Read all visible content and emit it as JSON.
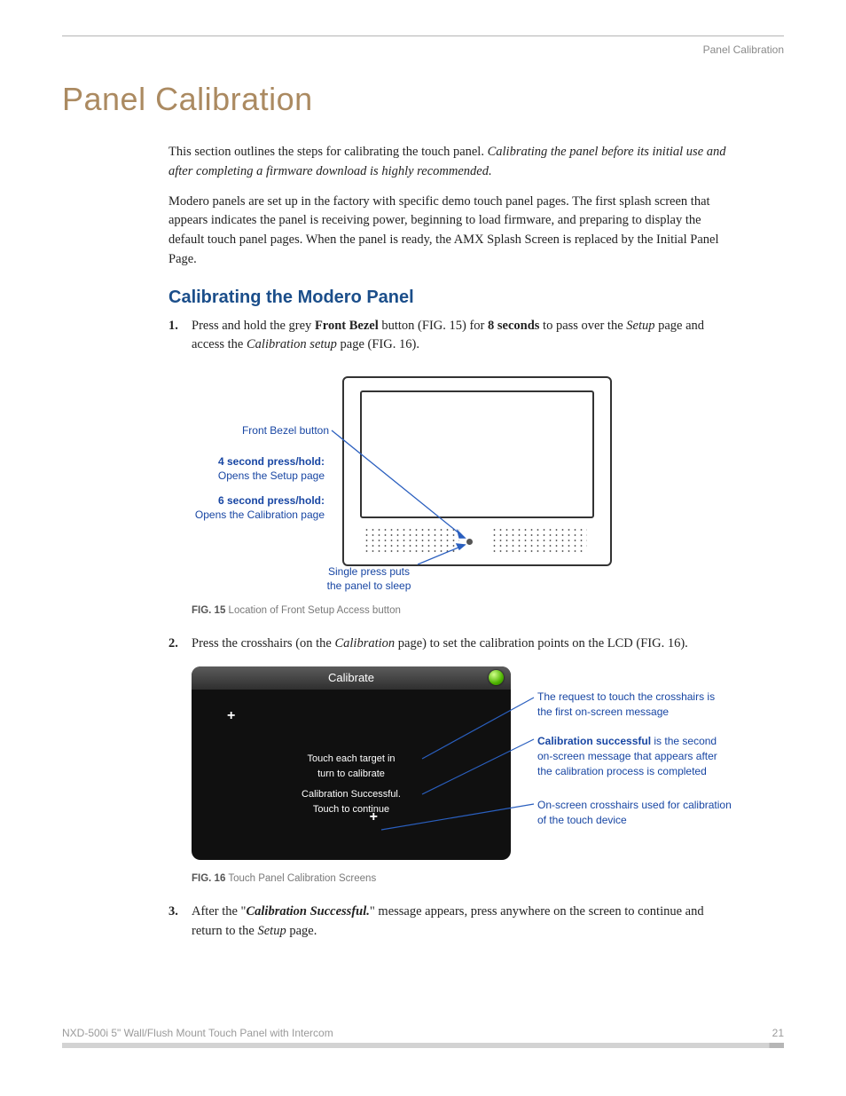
{
  "running_head": "Panel Calibration",
  "title": "Panel Calibration",
  "intro": {
    "p1_a": "This section outlines the steps for calibrating the touch panel. ",
    "p1_b": "Calibrating the panel before its initial use and after completing a firmware download is highly recommended.",
    "p2": "Modero panels are set up in the factory with specific demo touch panel pages. The first splash screen that appears indicates the panel is receiving power, beginning to load firmware, and preparing to display the default touch panel pages. When the panel is ready, the AMX Splash Screen is replaced by the Initial Panel Page."
  },
  "sub1": "Calibrating the Modero Panel",
  "step1": {
    "a": "Press and hold the grey ",
    "b": "Front Bezel",
    "c": " button (FIG. 15) for ",
    "d": "8 seconds",
    "e": " to pass over the ",
    "f": "Setup",
    "g": " page and access the ",
    "h": "Calibration setup",
    "i": " page (FIG. 16)."
  },
  "fig15": {
    "labels": {
      "bezel": "Front Bezel button",
      "hold4_title": "4 second press/hold:",
      "hold4_sub": "Opens the Setup page",
      "hold6_title": "6 second press/hold:",
      "hold6_sub": "Opens the Calibration page",
      "single_a": "Single press puts",
      "single_b": "the panel to sleep"
    },
    "caption_num": "FIG. 15",
    "caption": "  Location of Front Setup Access button"
  },
  "step2": {
    "a": "Press the crosshairs (on the ",
    "b": "Calibration",
    "c": " page) to set the calibration points on the LCD (FIG. 16)."
  },
  "fig16": {
    "screen": {
      "title": "Calibrate",
      "msg1_a": "Touch each target in",
      "msg1_b": "turn to calibrate",
      "msg2_a": "Calibration Successful.",
      "msg2_b": "Touch to continue",
      "cross": "+"
    },
    "annot1": "The request to touch the crosshairs is the first on-screen message",
    "annot2_bold": "Calibration successful",
    "annot2_rest": " is the second on-screen message that appears after the calibration process is completed",
    "annot3": "On-screen crosshairs used for calibration of the touch device",
    "caption_num": "FIG. 16",
    "caption": "  Touch Panel Calibration Screens"
  },
  "step3": {
    "a": "After the \"",
    "b": "Calibration Successful.",
    "c": "\" message appears, press anywhere on the screen to continue and return to the ",
    "d": "Setup",
    "e": " page."
  },
  "footer": {
    "left": "NXD-500i 5\" Wall/Flush Mount Touch Panel with Intercom",
    "right": "21"
  }
}
